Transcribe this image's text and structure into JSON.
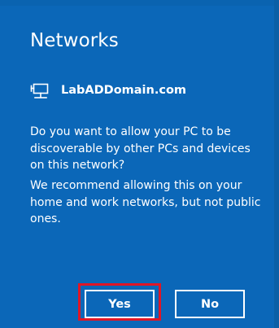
{
  "dialog": {
    "title": "Networks",
    "network_name": "LabADDomain.com",
    "question": "Do you want to allow your PC to be discoverable by other PCs and devices on this network?",
    "recommendation": "We recommend allowing this on your home and work networks, but not public ones."
  },
  "buttons": {
    "yes_label": "Yes",
    "no_label": "No"
  },
  "colors": {
    "background": "#0b67b8",
    "text": "#ffffff",
    "highlight": "#e01626"
  },
  "icons": {
    "network": "wired-network-icon"
  }
}
